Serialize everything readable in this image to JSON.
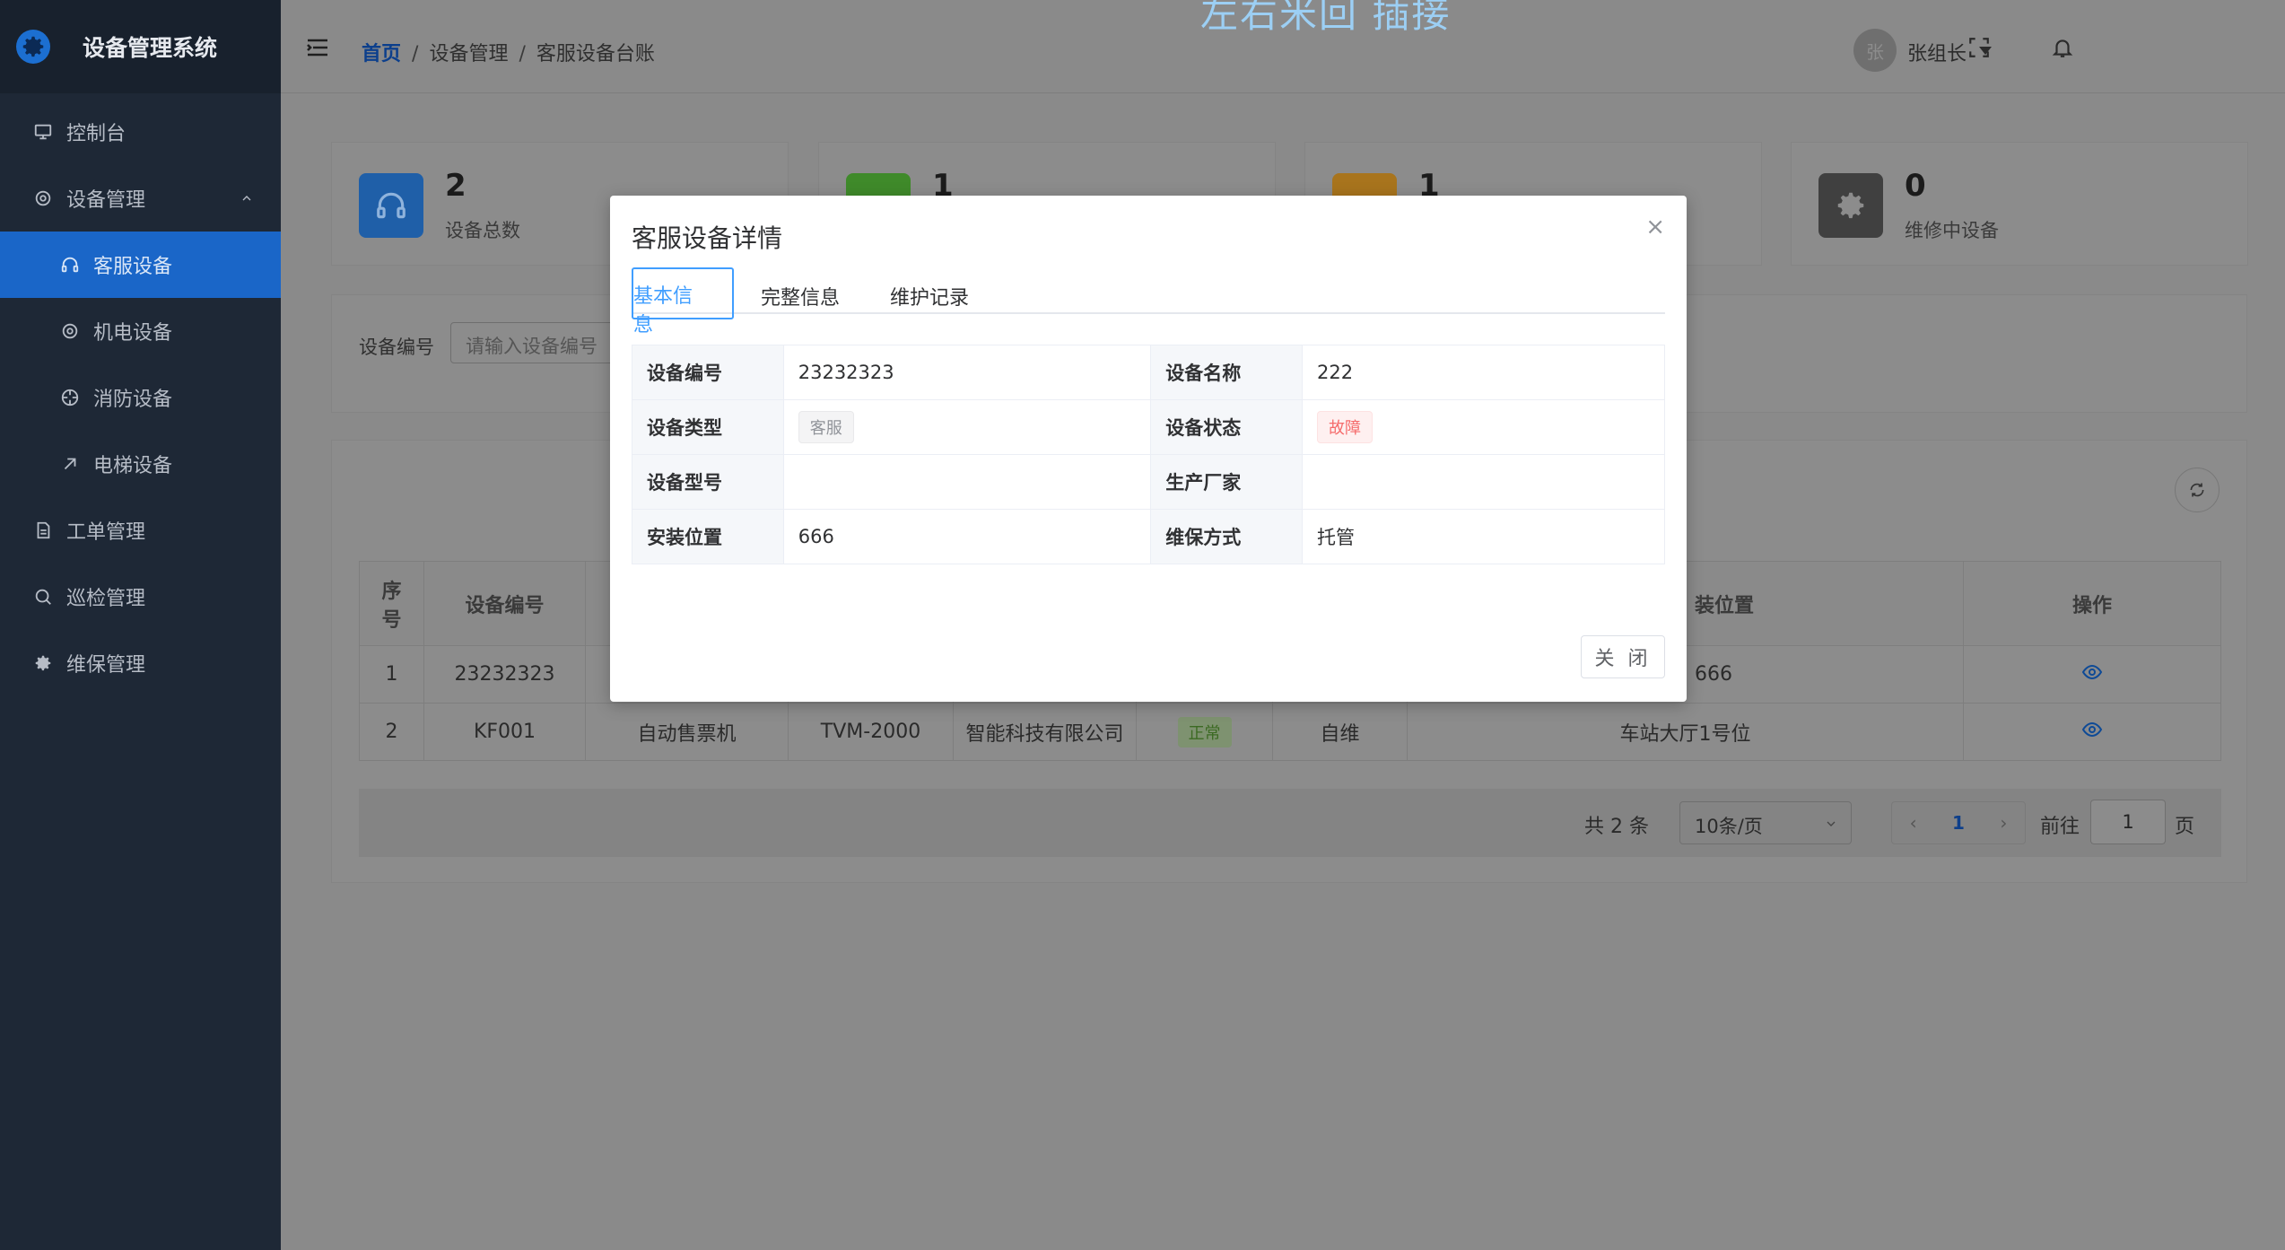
{
  "app": {
    "title": "设备管理系统",
    "watermark": "左右米回 插接"
  },
  "colors": {
    "accent": "#409eff",
    "active_menu": "#1a66c8",
    "danger": "#f56c6c",
    "success": "#67c23a"
  },
  "sidebar": {
    "items": [
      {
        "label": "控制台",
        "icon": "monitor-icon"
      },
      {
        "label": "设备管理",
        "icon": "gear-icon"
      },
      {
        "label": "客服设备",
        "icon": "headset-icon"
      },
      {
        "label": "机电设备",
        "icon": "gear-icon"
      },
      {
        "label": "消防设备",
        "icon": "target-icon"
      },
      {
        "label": "电梯设备",
        "icon": "arrow-up-right-icon"
      },
      {
        "label": "工单管理",
        "icon": "document-icon"
      },
      {
        "label": "巡检管理",
        "icon": "search-icon"
      },
      {
        "label": "维保管理",
        "icon": "settings-icon"
      }
    ]
  },
  "header": {
    "breadcrumb": [
      "首页",
      "设备管理",
      "客服设备台账"
    ],
    "avatar_char": "张",
    "username": "张组长"
  },
  "stats": [
    {
      "value": "2",
      "label": "设备总数",
      "color": "#1f5fa8",
      "icon": "headset-icon"
    },
    {
      "value": "1",
      "label": "",
      "color": "#3f8a2a",
      "icon": "check-icon"
    },
    {
      "value": "1",
      "label": "",
      "color": "#a8741d",
      "icon": "warning-icon"
    },
    {
      "value": "0",
      "label": "维修中设备",
      "color": "#404040",
      "icon": "settings-icon"
    }
  ],
  "filter": {
    "label": "设备编号",
    "placeholder": "请输入设备编号"
  },
  "table": {
    "headers": [
      "序号",
      "设备编号",
      "",
      "",
      "",
      "",
      "",
      "装位置",
      "操作"
    ],
    "rows": [
      {
        "idx": "1",
        "code": "23232323",
        "name": "",
        "model": "",
        "maker": "",
        "status": "",
        "mode": "",
        "location": "666"
      },
      {
        "idx": "2",
        "code": "KF001",
        "name": "自动售票机",
        "model": "TVM-2000",
        "maker": "智能科技有限公司",
        "status": "正常",
        "mode": "自维",
        "location": "车站大厅1号位"
      }
    ]
  },
  "pager": {
    "total": "共 2 条",
    "size": "10条/页",
    "current": "1",
    "goto": "前往",
    "goto_value": "1",
    "page_unit": "页"
  },
  "modal": {
    "title": "客服设备详情",
    "tabs": [
      "基本信息",
      "完整信息",
      "维护记录"
    ],
    "fields": {
      "code_label": "设备编号",
      "code": "23232323",
      "name_label": "设备名称",
      "name": "222",
      "type_label": "设备类型",
      "type": "客服",
      "status_label": "设备状态",
      "status": "故障",
      "model_label": "设备型号",
      "model": "",
      "maker_label": "生产厂家",
      "maker": "",
      "location_label": "安装位置",
      "location": "666",
      "mode_label": "维保方式",
      "mode": "托管"
    },
    "close_label": "关 闭"
  }
}
